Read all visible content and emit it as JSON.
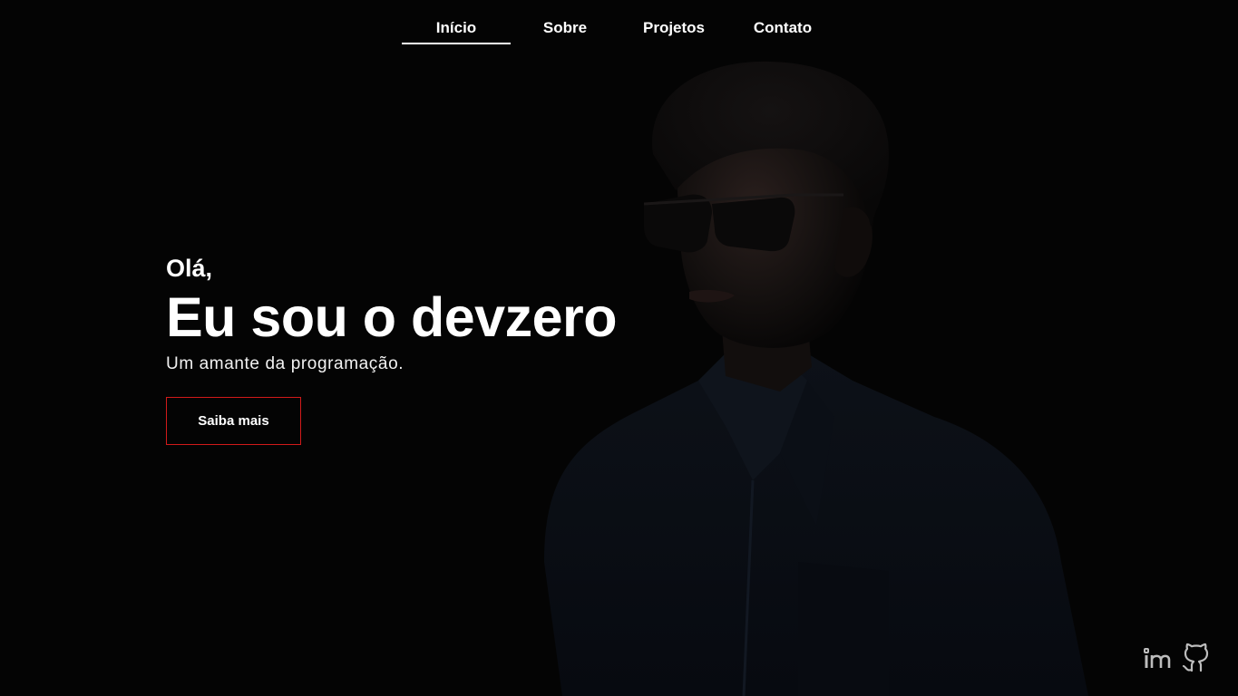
{
  "nav": {
    "items": [
      {
        "label": "Início",
        "active": true
      },
      {
        "label": "Sobre",
        "active": false
      },
      {
        "label": "Projetos",
        "active": false
      },
      {
        "label": "Contato",
        "active": false
      }
    ]
  },
  "hero": {
    "greeting": "Olá,",
    "headline": "Eu sou o devzero",
    "subtitle": "Um amante da programação.",
    "cta_label": "Saiba mais"
  },
  "social": {
    "icons": [
      "linkedin-icon",
      "github-icon"
    ]
  },
  "colors": {
    "background": "#040404",
    "text": "#ffffff",
    "accent_border": "#d11a1a"
  }
}
